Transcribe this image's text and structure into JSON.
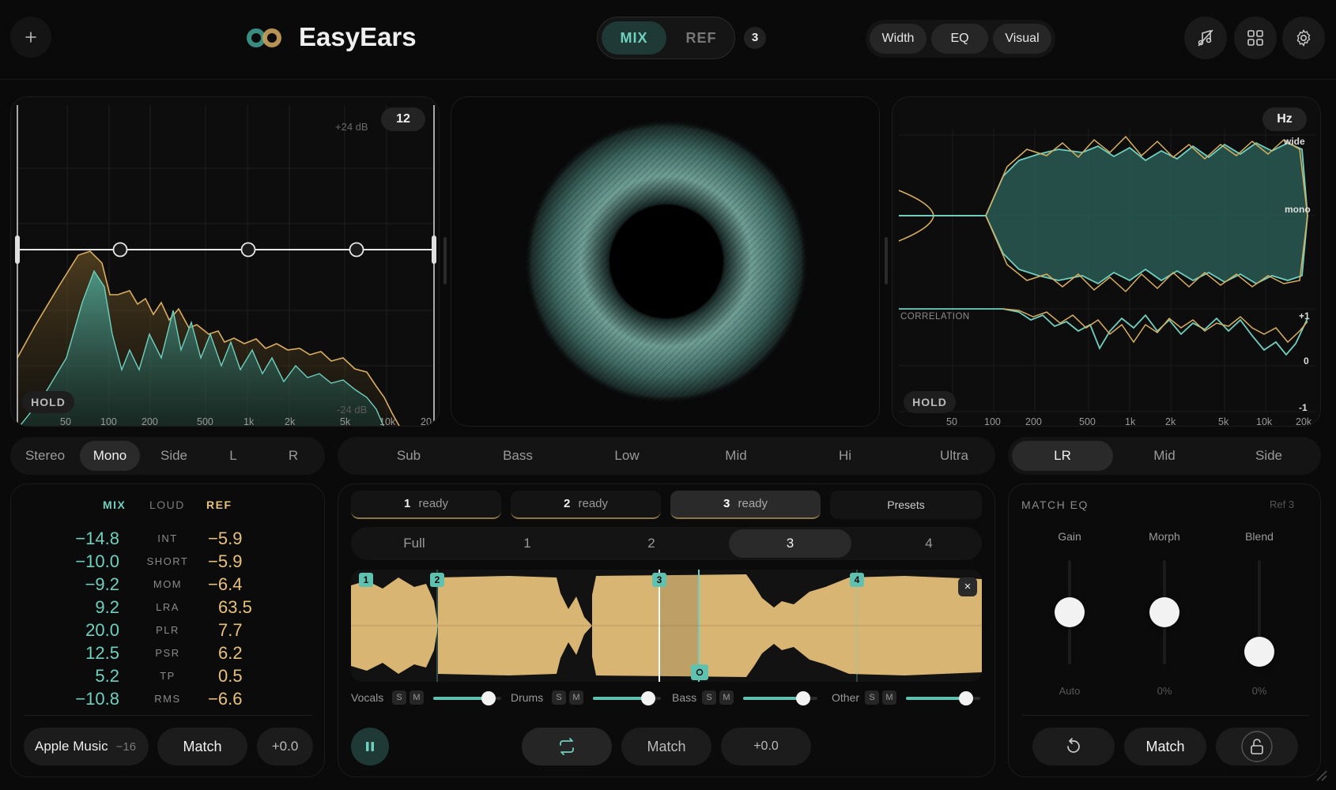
{
  "app": {
    "title": "EasyEars"
  },
  "header": {
    "mix_label": "MIX",
    "ref_label": "REF",
    "ref_count": "3",
    "view_tabs": [
      "Width",
      "EQ",
      "Visual"
    ]
  },
  "spectrum": {
    "resolution": "12",
    "db_top": "+24 dB",
    "db_bottom": "-24 dB",
    "hold_label": "HOLD",
    "freq_ticks": [
      "50",
      "100",
      "200",
      "500",
      "1k",
      "2k",
      "5k",
      "10k",
      "20"
    ]
  },
  "width_panel": {
    "unit_label": "Hz",
    "wide_label": "wide",
    "mono_label": "mono",
    "correlation_label": "CORRELATION",
    "corr_plus": "+1",
    "corr_zero": "0",
    "corr_minus": "-1",
    "hold_label": "HOLD",
    "freq_ticks": [
      "50",
      "100",
      "200",
      "500",
      "1k",
      "2k",
      "5k",
      "10k",
      "20k"
    ]
  },
  "channel_tabs": [
    "Stereo",
    "Mono",
    "Side",
    "L",
    "R"
  ],
  "band_tabs": [
    "Sub",
    "Bass",
    "Low",
    "Mid",
    "Hi",
    "Ultra"
  ],
  "mode_tabs": [
    "LR",
    "Mid",
    "Side"
  ],
  "loudness": {
    "col_mix": "MIX",
    "col_loud": "LOUD",
    "col_ref": "REF",
    "rows": [
      {
        "mix": "−14.8",
        "label": "INT",
        "ref": "−5.9"
      },
      {
        "mix": "−10.0",
        "label": "SHORT",
        "ref": "−5.9"
      },
      {
        "mix": "−9.2",
        "label": "MOM",
        "ref": "−6.4"
      },
      {
        "mix": "9.2",
        "label": "LRA",
        "ref": "63.5"
      },
      {
        "mix": "20.0",
        "label": "PLR",
        "ref": "7.7"
      },
      {
        "mix": "12.5",
        "label": "PSR",
        "ref": "6.2"
      },
      {
        "mix": "5.2",
        "label": "TP",
        "ref": "0.5"
      },
      {
        "mix": "−10.8",
        "label": "RMS",
        "ref": "−6.6"
      }
    ],
    "target_name": "Apple Music",
    "target_value": "−16",
    "match_label": "Match",
    "offset_label": "+0.0"
  },
  "refs": {
    "slots": [
      {
        "num": "1",
        "status": "ready"
      },
      {
        "num": "2",
        "status": "ready"
      },
      {
        "num": "3",
        "status": "ready"
      }
    ],
    "presets_label": "Presets",
    "sections": [
      "Full",
      "1",
      "2",
      "3",
      "4"
    ],
    "markers": [
      "1",
      "2",
      "3",
      "4"
    ],
    "close_label": "×",
    "stems": [
      {
        "name": "Vocals",
        "s": "S",
        "m": "M",
        "level": 0.8
      },
      {
        "name": "Drums",
        "s": "S",
        "m": "M",
        "level": 0.8
      },
      {
        "name": "Bass",
        "s": "S",
        "m": "M",
        "level": 0.8
      },
      {
        "name": "Other",
        "s": "S",
        "m": "M",
        "level": 0.8
      }
    ],
    "match_label": "Match",
    "offset_label": "+0.0"
  },
  "match_eq": {
    "title": "MATCH EQ",
    "ref_label": "Ref 3",
    "sliders": [
      {
        "name": "Gain",
        "value": "Auto",
        "level": 0.5
      },
      {
        "name": "Morph",
        "value": "0%",
        "level": 0.5
      },
      {
        "name": "Blend",
        "value": "0%",
        "level": 0.12
      }
    ],
    "match_label": "Match"
  },
  "colors": {
    "mix": "#6fd0bf",
    "ref": "#e8c17a",
    "bg": "#0a0a0a"
  }
}
